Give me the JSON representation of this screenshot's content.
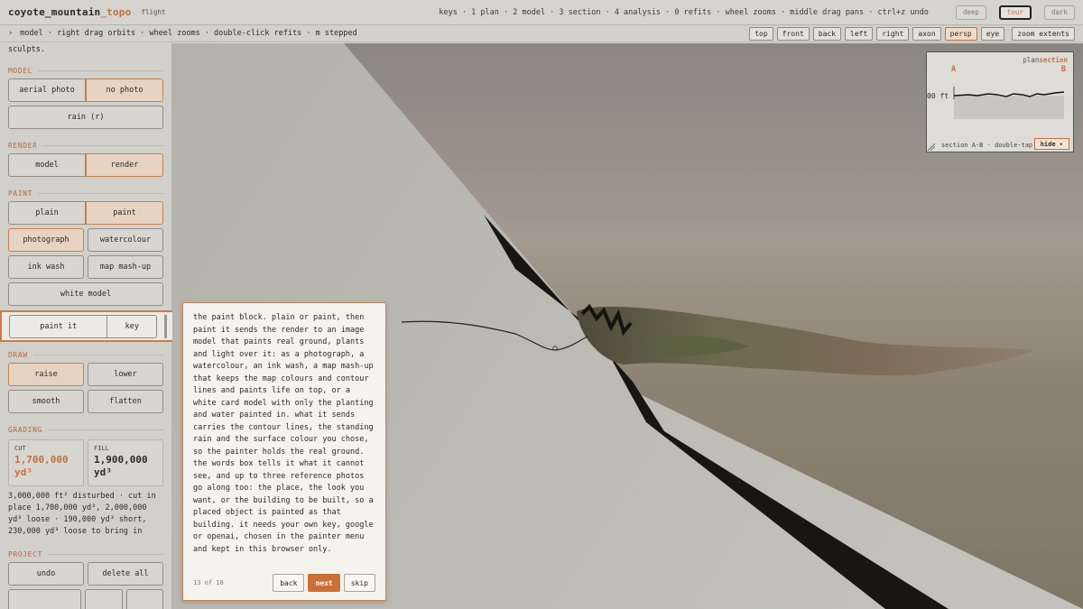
{
  "app": {
    "name": "coyote_mountain",
    "name_suffix": "_topo",
    "tag": "flight"
  },
  "topbar": {
    "key_hints": "keys · 1 plan · 2 model · 3 section · 4 analysis · 0 refits · wheel zooms · middle drag pans · ctrl+z undo",
    "themes": [
      "deep",
      "tour",
      "dark"
    ],
    "active_theme": "tour"
  },
  "subbar": {
    "chevron": "›",
    "hint": "model · right drag orbits · wheel zooms · double-click refits · m stepped",
    "views": [
      "top",
      "front",
      "back",
      "left",
      "right",
      "axon",
      "persp",
      "eye"
    ],
    "active_view": "persp",
    "extents_label": "zoom extents"
  },
  "sidebar": {
    "intro": "sculpts.",
    "model": {
      "title": "MODEL",
      "aerial": "aerial photo",
      "no_photo": "no photo",
      "rain": "rain (r)"
    },
    "render": {
      "title": "RENDER",
      "model": "model",
      "render": "render"
    },
    "paint": {
      "title": "PAINT",
      "plain": "plain",
      "paint": "paint",
      "photograph": "photograph",
      "watercolour": "watercolour",
      "ink_wash": "ink wash",
      "map_mashup": "map mash-up",
      "white_model": "white model",
      "paint_it": "paint it",
      "key": "key"
    },
    "draw": {
      "title": "DRAW",
      "raise": "raise",
      "lower": "lower",
      "smooth": "smooth",
      "flatten": "flatten"
    },
    "grading": {
      "title": "GRADING",
      "cut_label": "CUT",
      "cut_value": "1,700,000 yd³",
      "fill_label": "FILL",
      "fill_value": "1,900,000 yd³",
      "note": "3,000,000 ft² disturbed · cut in place 1,700,000 yd³, 2,000,000 yd³ loose · 190,000 yd³ short, 230,000 yd³ loose to bring in"
    },
    "project": {
      "title": "PROJECT",
      "undo": "undo",
      "delete_all": "delete all"
    }
  },
  "inset": {
    "tab_plan": "plan",
    "tab_section": "section",
    "label_a": "A",
    "label_b": "B",
    "elevation": "00 ft",
    "footer": "section A-B · double-tap",
    "hide": "hide ▾"
  },
  "tour": {
    "text": "the paint block. plain or paint, then paint it sends the render to an image model that paints real ground, plants and light over it: as a photograph, a watercolour, an ink wash, a map mash-up that keeps the map colours and contour lines and paints life on top, or a white card model with only the planting and water painted in. what it sends carries the contour lines, the standing rain and the surface colour you chose, so the painter holds the real ground. the words box tells it what it cannot see, and up to three reference photos go along too: the place, the look you want, or the building to be built, so a placed object is painted as that building. it needs your own key, google or openai, chosen in the painter menu and kept in this browser only.",
    "counter": "13 of 18",
    "back": "back",
    "next": "next",
    "skip": "skip"
  },
  "colors": {
    "accent": "#c0713f",
    "terrain_dark": "#141310"
  }
}
